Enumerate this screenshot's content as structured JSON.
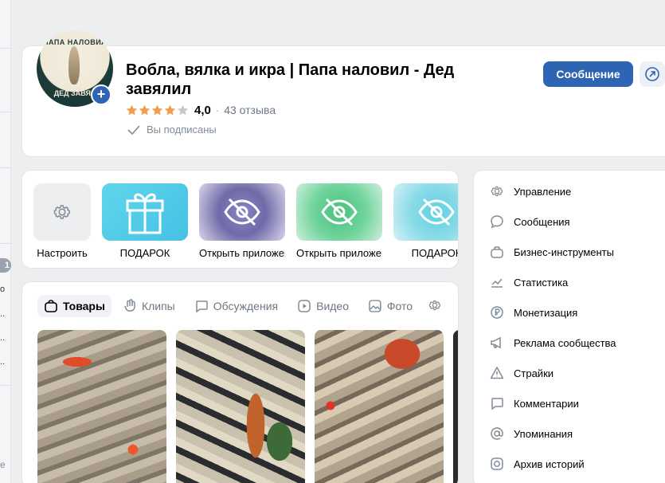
{
  "sidebar_fragment": {
    "badge": "1",
    "dots": [
      "о",
      "..",
      "..",
      ".."
    ],
    "tail": "е"
  },
  "community": {
    "avatar_text_top": "ПАПА НАЛОВИЛ",
    "avatar_text_bottom": "ДЕД ЗАВЯЛ",
    "title": "Вобла, вялка и икра | Папа наловил - Дед завялил",
    "rating": "4,0",
    "rating_stars": 4,
    "reviews": "43 отзыва",
    "subscribed": "Вы подписаны",
    "message_button": "Сообщение"
  },
  "apps": [
    {
      "label": "Настроить",
      "icon": "gear-icon"
    },
    {
      "label": "ПОДАРОК",
      "icon": "gift-icon"
    },
    {
      "label": "Открыть приложение",
      "icon": "eye-off-icon"
    },
    {
      "label": "Открыть приложение",
      "icon": "eye-off-icon"
    },
    {
      "label": "ПОДАРОК",
      "icon": "eye-off-icon"
    }
  ],
  "tabs": [
    {
      "label": "Товары",
      "icon": "bag-icon",
      "active": true
    },
    {
      "label": "Клипы",
      "icon": "clip-icon",
      "active": false
    },
    {
      "label": "Обсуждения",
      "icon": "chat-icon",
      "active": false
    },
    {
      "label": "Видео",
      "icon": "video-icon",
      "active": false
    },
    {
      "label": "Фото",
      "icon": "photo-icon",
      "active": false
    }
  ],
  "menu": [
    {
      "label": "Управление",
      "icon": "gear-icon"
    },
    {
      "label": "Сообщения",
      "icon": "message-icon"
    },
    {
      "label": "Бизнес-инструменты",
      "icon": "briefcase-icon"
    },
    {
      "label": "Статистика",
      "icon": "stats-icon"
    },
    {
      "label": "Монетизация",
      "icon": "ruble-icon"
    },
    {
      "label": "Реклама сообщества",
      "icon": "megaphone-icon"
    },
    {
      "label": "Страйки",
      "icon": "warning-icon"
    },
    {
      "label": "Комментарии",
      "icon": "comment-icon"
    },
    {
      "label": "Упоминания",
      "icon": "at-icon"
    },
    {
      "label": "Архив историй",
      "icon": "story-icon"
    }
  ],
  "colors": {
    "accent": "#2d64b3",
    "star": "#f2994a",
    "star_empty": "#c4c8cc"
  }
}
